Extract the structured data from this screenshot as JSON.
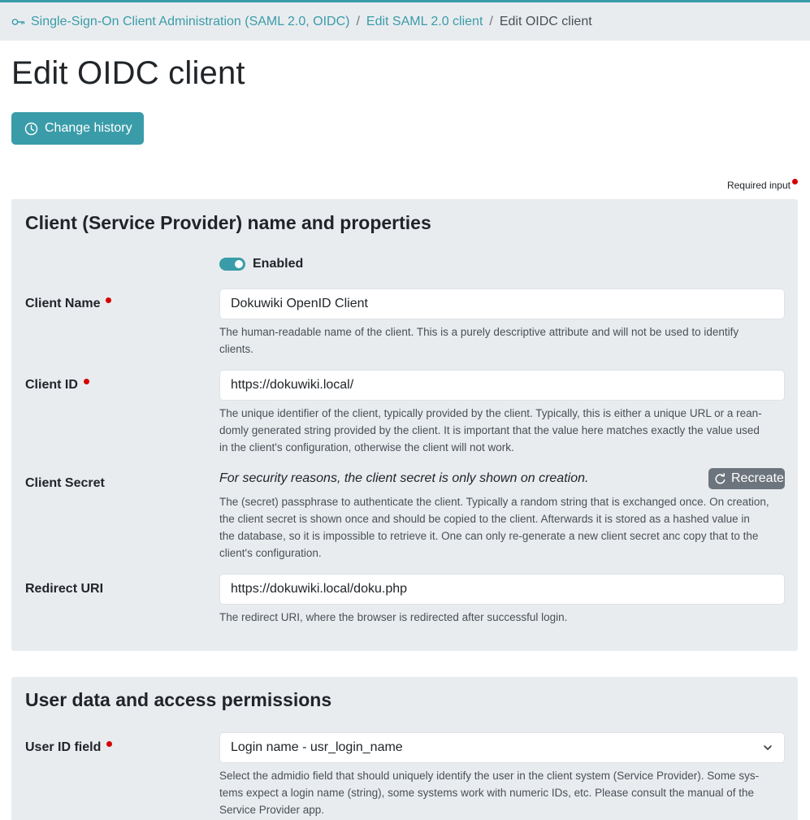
{
  "breadcrumb": {
    "items": [
      "Single-Sign-On Client Administration (SAML 2.0, OIDC)",
      "Edit SAML 2.0 client"
    ],
    "current": "Edit OIDC client"
  },
  "page_title": "Edit OIDC client",
  "change_history_label": "Change history",
  "required_note": "Required input",
  "section1": {
    "title": "Client (Service Provider) name and properties",
    "enabled_label": "Enabled",
    "client_name": {
      "label": "Client Name",
      "value": "Dokuwiki OpenID Client",
      "help_lines": [
        "The human-readable name of the client. This is a purely descriptive attribute and will not be used to identify",
        "clients."
      ]
    },
    "client_id": {
      "label": "Client ID",
      "value": "https://dokuwiki.local/",
      "help_lines": [
        "The unique identifier of the client, typically provided by the client. Typically, this is either a unique URL or a rean-",
        "domly generated string provided by the client. It is important that the value here matches exactly the value used",
        "in the client's configuration, otherwise the client will not work."
      ]
    },
    "client_secret": {
      "label": "Client Secret",
      "note": "For security reasons, the client secret is only shown on creation.",
      "recreate_label": "Recreate",
      "help_lines": [
        "The (secret) passphrase to authenticate the client. Typically a random string that is exchanged once. On creation,",
        "the client secret is shown once and should be copied to the client. Afterwards it is stored as a hashed value in",
        "the database, so it is impossible to retrieve it. One can only re-generate a new client secret anc copy that to the",
        "client's configuration."
      ]
    },
    "redirect_uri": {
      "label": "Redirect URI",
      "value": "https://dokuwiki.local/doku.php",
      "help_lines": [
        "The redirect URI, where the browser is redirected after successful login."
      ]
    }
  },
  "section2": {
    "title": "User data and access permissions",
    "user_id_field": {
      "label": "User ID field",
      "selected": "Login name - usr_login_name",
      "help_lines": [
        "Select the admidio field that should uniquely identify the user in the client system (Service Provider). Some sys-",
        "tems expect a login name (string), some systems work with numeric IDs, etc. Please consult the manual of the",
        "Service Provider app."
      ]
    }
  },
  "colors": {
    "accent": "#3a9ca9",
    "required": "#d50000",
    "card_bg": "#e9ecef",
    "secondary_button": "#6c757d"
  }
}
